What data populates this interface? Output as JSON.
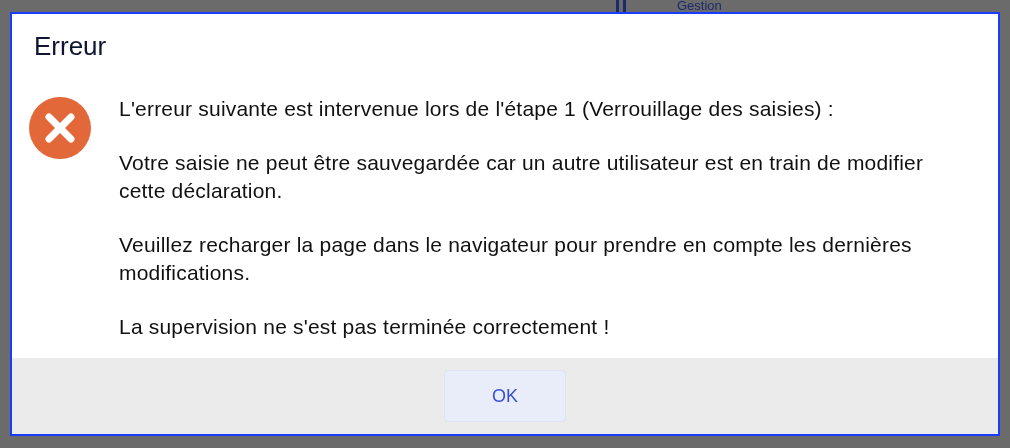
{
  "background": {
    "label": "Gestion"
  },
  "dialog": {
    "title": "Erreur",
    "paragraphs": [
      "L'erreur suivante est intervenue lors de l'étape 1 (Verrouillage des saisies) :",
      "Votre saisie ne peut être sauvegardée car un autre utilisateur est en train de modifier cette déclaration.",
      "Veuillez recharger la page dans le navigateur pour prendre en compte les dernières modifications.",
      "La supervision ne s'est pas terminée correctement !"
    ],
    "buttons": [
      "OK"
    ]
  }
}
